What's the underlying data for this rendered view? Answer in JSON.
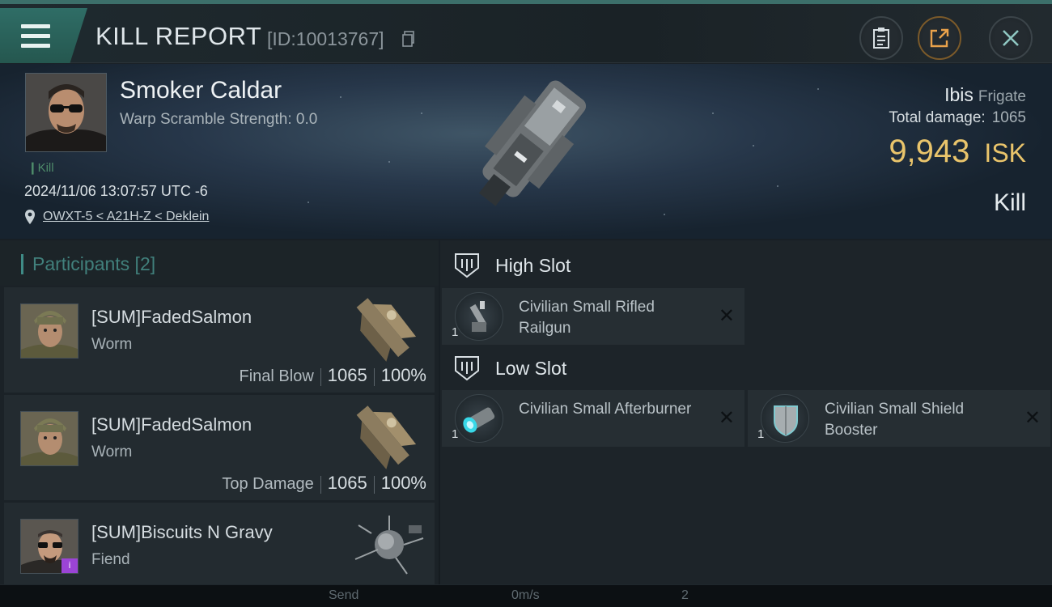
{
  "header": {
    "title": "KILL REPORT",
    "report_id": "[ID:10013767]",
    "icons": [
      "menu-icon",
      "clipboard-icon",
      "share-icon",
      "close-icon"
    ]
  },
  "victim": {
    "name": "Smoker Caldar",
    "warp_scramble": "Warp Scramble Strength: 0.0",
    "kill_tag": "Kill",
    "datetime": "2024/11/06 13:07:57 UTC -6",
    "location": "OWXT-5 < A21H-Z < Deklein",
    "ship_name": "Ibis",
    "ship_class": "Frigate",
    "total_damage_label": "Total damage:",
    "total_damage": "1065",
    "isk_value": "9,943",
    "isk_unit": "ISK",
    "result": "Kill"
  },
  "participants": {
    "title": "Participants [2]",
    "rows": [
      {
        "name": "[SUM]FadedSalmon",
        "ship": "Worm",
        "tag": "Final Blow",
        "damage": "1065",
        "percent": "100%"
      },
      {
        "name": "[SUM]FadedSalmon",
        "ship": "Worm",
        "tag": "Top Damage",
        "damage": "1065",
        "percent": "100%"
      },
      {
        "name": "[SUM]Biscuits N Gravy",
        "ship": "Fiend"
      }
    ]
  },
  "fitting": {
    "high_slot": {
      "label": "High Slot",
      "modules": [
        {
          "qty": "1",
          "name": "Civilian Small Rifled Railgun"
        }
      ]
    },
    "low_slot": {
      "label": "Low Slot",
      "modules": [
        {
          "qty": "1",
          "name": "Civilian Small Afterburner"
        },
        {
          "qty": "1",
          "name": "Civilian Small Shield Booster"
        }
      ]
    }
  },
  "hud": {
    "send": "Send",
    "speed": "0m/s",
    "count": "2"
  },
  "colors": {
    "accent_teal": "#3f8b86",
    "isk_gold": "#e9c46b",
    "badge_purple": "#9b44d6"
  }
}
